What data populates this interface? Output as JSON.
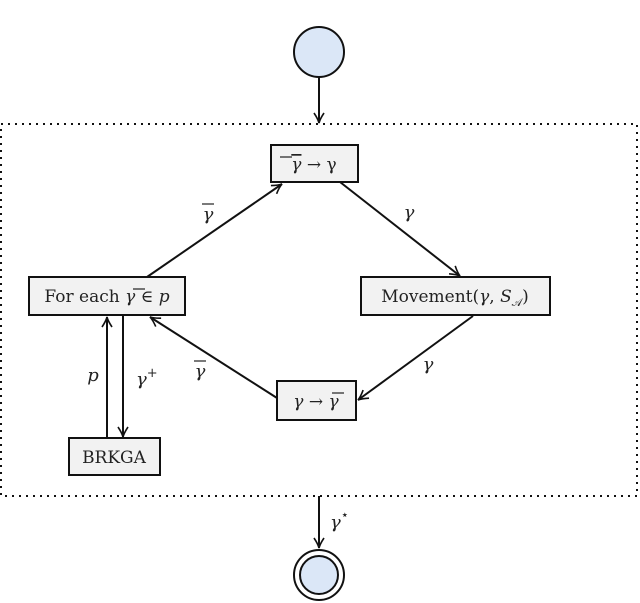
{
  "diagram": {
    "type": "flow-diagram",
    "start_state": {
      "name": "start"
    },
    "end_state": {
      "name": "end",
      "style": "double-circle"
    },
    "fill_color_state": "#dbe7f7",
    "fill_color_box": "#f2f2f2",
    "nodes": {
      "decode": {
        "label_bar": "γ",
        "label_rest": "  → γ"
      },
      "for_each": {
        "label_prefix": "For each ",
        "label_bar": "γ",
        "label_rest": " ∈  ",
        "label_var": "p"
      },
      "movement": {
        "label_prefix": "Movement(",
        "label_var1": "γ",
        "label_mid": ", ",
        "label_var2": "S",
        "label_sub": "𝒜",
        "label_suffix": ")"
      },
      "encode": {
        "label_var": "γ",
        "label_arrow": " → ",
        "label_bar": "γ"
      },
      "brkga": {
        "label": "BRKGA"
      }
    },
    "edges": {
      "start_to_frame": {
        "label": ""
      },
      "foreach_to_decode": {
        "label": "γ",
        "overline": true
      },
      "decode_to_movement": {
        "label": "γ"
      },
      "movement_to_encode": {
        "label": "γ"
      },
      "encode_to_foreach": {
        "label": "γ",
        "overline": true
      },
      "brkga_to_foreach": {
        "label": "p"
      },
      "foreach_to_brkga": {
        "label": "γ",
        "sup": "+"
      },
      "frame_to_end": {
        "label": "γ",
        "sup": "⋆"
      }
    }
  }
}
